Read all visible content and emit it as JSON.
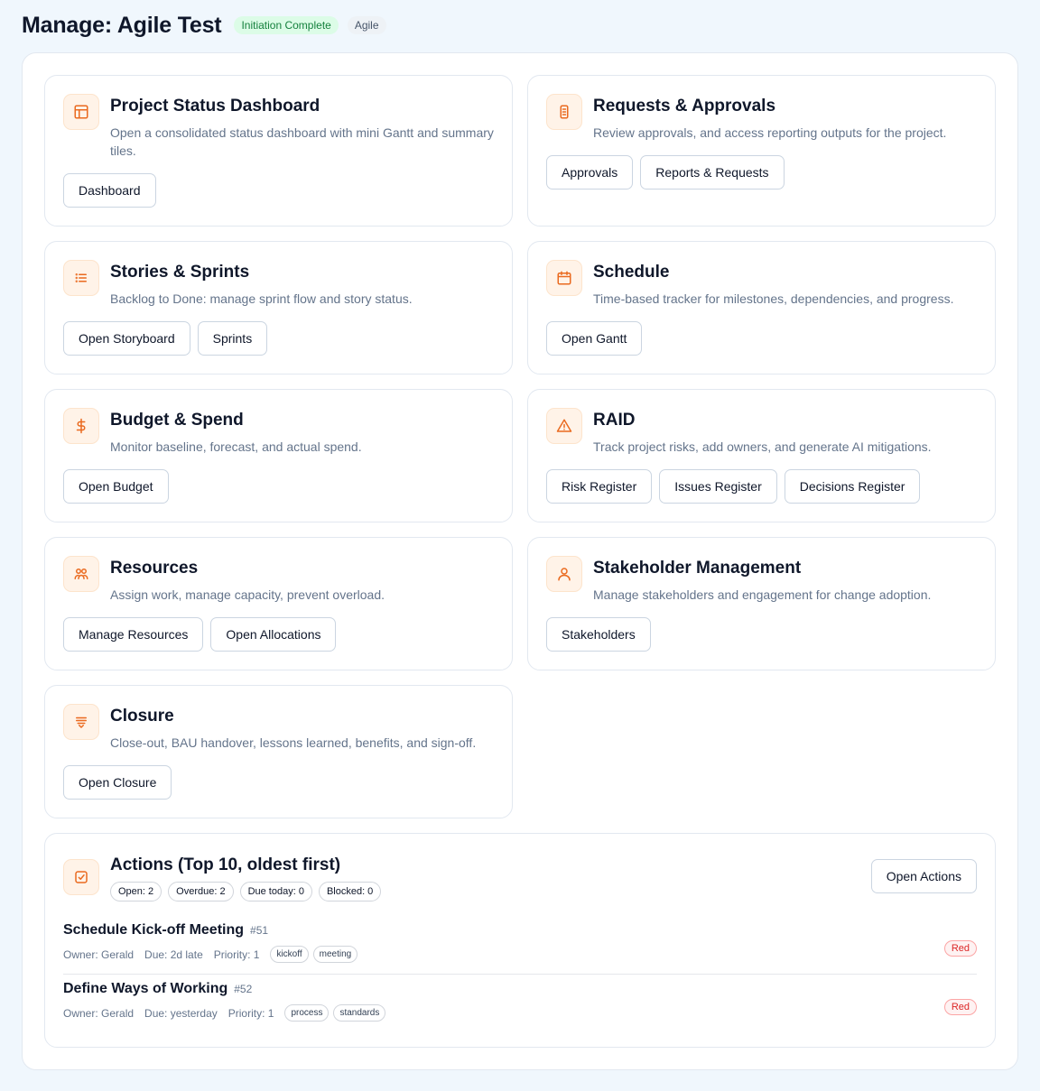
{
  "header": {
    "title": "Manage: Agile Test",
    "status_badge": "Initiation Complete",
    "method_badge": "Agile"
  },
  "cards": [
    {
      "title": "Project Status Dashboard",
      "description": "Open a consolidated status dashboard with mini Gantt and summary tiles.",
      "icon": "layout-icon",
      "buttons": [
        "Dashboard"
      ]
    },
    {
      "title": "Requests & Approvals",
      "description": "Review approvals, and access reporting outputs for the project.",
      "icon": "scroll-icon",
      "buttons": [
        "Approvals",
        "Reports & Requests"
      ]
    },
    {
      "title": "Stories & Sprints",
      "description": "Backlog to Done: manage sprint flow and story status.",
      "icon": "list-icon",
      "buttons": [
        "Open Storyboard",
        "Sprints"
      ]
    },
    {
      "title": "Schedule",
      "description": "Time-based tracker for milestones, dependencies, and progress.",
      "icon": "calendar-icon",
      "buttons": [
        "Open Gantt"
      ]
    },
    {
      "title": "Budget & Spend",
      "description": "Monitor baseline, forecast, and actual spend.",
      "icon": "dollar-icon",
      "buttons": [
        "Open Budget"
      ]
    },
    {
      "title": "RAID",
      "description": "Track project risks, add owners, and generate AI mitigations.",
      "icon": "warning-icon",
      "buttons": [
        "Risk Register",
        "Issues Register",
        "Decisions Register"
      ]
    },
    {
      "title": "Resources",
      "description": "Assign work, manage capacity, prevent overload.",
      "icon": "users-icon",
      "buttons": [
        "Manage Resources",
        "Open Allocations"
      ]
    },
    {
      "title": "Stakeholder Management",
      "description": "Manage stakeholders and engagement for change adoption.",
      "icon": "user-icon",
      "buttons": [
        "Stakeholders"
      ]
    },
    {
      "title": "Closure",
      "description": "Close-out, BAU handover, lessons learned, benefits, and sign-off.",
      "icon": "closure-icon",
      "buttons": [
        "Open Closure"
      ]
    }
  ],
  "actions": {
    "title": "Actions (Top 10, oldest first)",
    "icon": "check-square-icon",
    "open_button": "Open Actions",
    "counts": [
      "Open: 2",
      "Overdue: 2",
      "Due today: 0",
      "Blocked: 0"
    ],
    "items": [
      {
        "title": "Schedule Kick-off Meeting",
        "id": "#51",
        "owner": "Owner: Gerald",
        "due": "Due: 2d late",
        "priority": "Priority: 1",
        "tags": [
          "kickoff",
          "meeting"
        ],
        "rag": "Red"
      },
      {
        "title": "Define Ways of Working",
        "id": "#52",
        "owner": "Owner: Gerald",
        "due": "Due: yesterday",
        "priority": "Priority: 1",
        "tags": [
          "process",
          "standards"
        ],
        "rag": "Red"
      }
    ]
  },
  "colors": {
    "accent": "#ea6a1f",
    "background": "#f0f7fd",
    "status_green": "#15803d",
    "rag_red": "#dc2626"
  }
}
